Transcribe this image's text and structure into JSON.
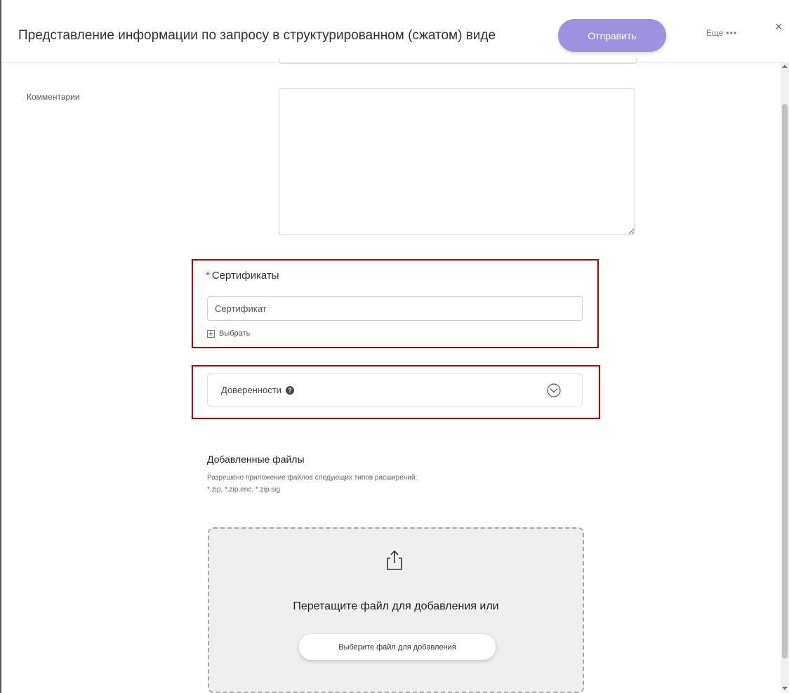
{
  "header": {
    "title": "Представление информации по запросу в структурированном (сжатом) виде",
    "send_label": "Отправить",
    "more_label": "Еще",
    "more_dots": "•••",
    "close_symbol": "×"
  },
  "comments": {
    "label": "Комментарии",
    "value": ""
  },
  "certificates": {
    "required_mark": "*",
    "title": "Сертификаты",
    "placeholder": "Сертификат",
    "choose_label": "Выбрать"
  },
  "trusts": {
    "label": "Доверенности",
    "help_glyph": "?"
  },
  "files": {
    "title": "Добавленные файлы",
    "note_line1": "Разрешено приложение файлов следующих типов расширений:",
    "note_line2": "*.zip, *.zip.enc, *.zip.sig",
    "drop_text": "Перетащите файл для добавления или",
    "pick_button": "Выберите файл для добавления"
  },
  "colors": {
    "accent": "#9e91e0",
    "required": "#e03030",
    "highlight_border": "#c00000"
  }
}
